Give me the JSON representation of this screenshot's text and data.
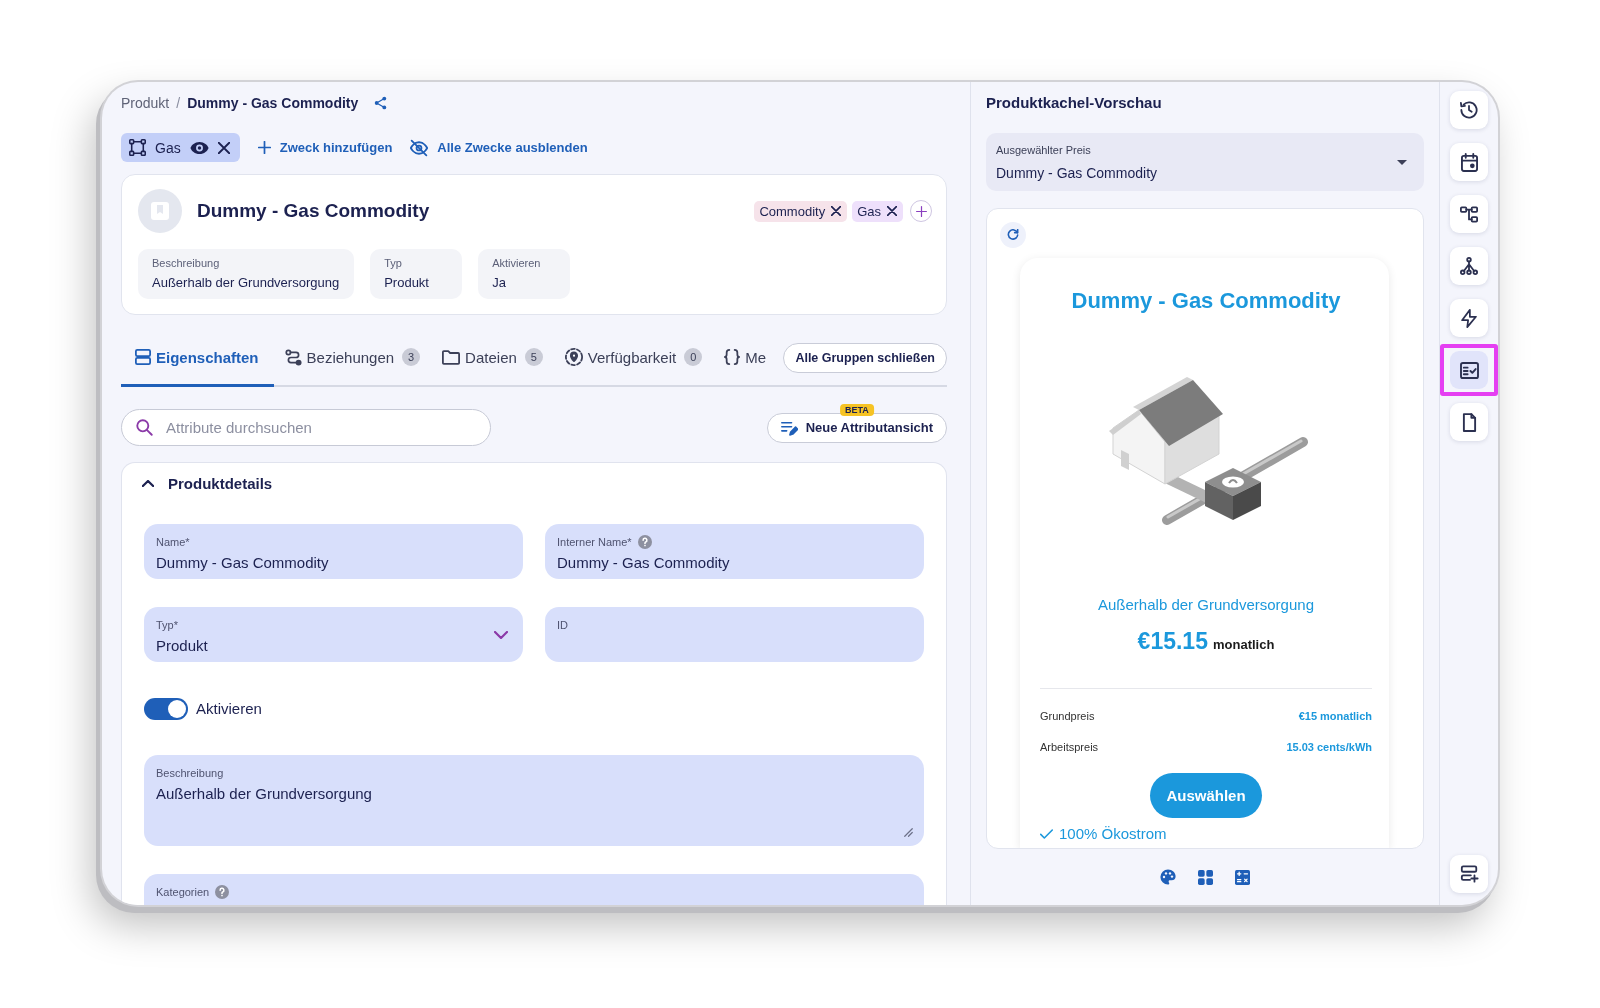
{
  "breadcrumb": {
    "items": [
      "Produkt",
      "Dummy - Gas Commodity"
    ],
    "separator": "/"
  },
  "purposes": {
    "chips": [
      {
        "label": "Gas"
      }
    ],
    "actions": [
      {
        "kind": "add",
        "label": "Zweck hinzufügen"
      },
      {
        "kind": "hide",
        "label": "Alle Zwecke ausblenden"
      }
    ]
  },
  "header": {
    "title": "Dummy - Gas Commodity",
    "tags": [
      {
        "label": "Commodity",
        "color": "#f6e3ea"
      },
      {
        "label": "Gas",
        "color": "#eee0fb"
      }
    ],
    "info": [
      {
        "label": "Beschreibung",
        "value": "Außerhalb der Grundversorgung"
      },
      {
        "label": "Typ",
        "value": "Produkt"
      },
      {
        "label": "Aktivieren",
        "value": "Ja"
      }
    ]
  },
  "tabs": {
    "items": [
      {
        "label": "Eigenschaften",
        "selected": true
      },
      {
        "label": "Beziehungen",
        "count": "3",
        "selected": false
      },
      {
        "label": "Dateien",
        "count": "5",
        "selected": false
      },
      {
        "label": "Verfügbarkeit",
        "count": "0",
        "selected": false
      },
      {
        "label": "Me",
        "selected": false
      }
    ],
    "collapse_button": "Alle Gruppen schließen"
  },
  "search": {
    "placeholder": "Attribute durchsuchen"
  },
  "view_button": {
    "label": "Neue Attributansicht",
    "badge": "BETA"
  },
  "section": {
    "title": "Produktdetails",
    "expanded": true,
    "fields": [
      {
        "kind": "text",
        "label": "Name*",
        "value": "Dummy - Gas Commodity",
        "help": false
      },
      {
        "kind": "text",
        "label": "Interner Name*",
        "value": "Dummy - Gas Commodity",
        "help": true
      },
      {
        "kind": "select",
        "label": "Typ*",
        "value": "Produkt",
        "help": false
      },
      {
        "kind": "text",
        "label": "ID",
        "help": false
      },
      {
        "kind": "toggle",
        "label": "Aktivieren",
        "on": true
      },
      {
        "kind": "textarea",
        "label": "Beschreibung",
        "value": "Außerhalb der Grundversorgung",
        "help": false
      },
      {
        "kind": "multiselect",
        "label": "Kategorien",
        "help": true
      }
    ]
  },
  "preview": {
    "title": "Produktkachel-Vorschau",
    "price_select": {
      "label": "Ausgewählter Preis",
      "value": "Dummy - Gas Commodity"
    },
    "tile": {
      "title": "Dummy - Gas Commodity",
      "subtitle": "Außerhalb der Grundversorgung",
      "price": "€15.15",
      "period": "monatlich",
      "rows": [
        {
          "label": "Grundpreis",
          "value": "€15 monatlich"
        },
        {
          "label": "Arbeitspreis",
          "value": "15.03 cents/kWh"
        }
      ],
      "button": "Auswählen",
      "features": [
        "100% Ökostrom"
      ]
    }
  },
  "rail": {
    "items": [
      {
        "selected": false
      },
      {
        "selected": false
      },
      {
        "selected": false
      },
      {
        "selected": false
      },
      {
        "selected": false
      },
      {
        "selected": true
      },
      {
        "selected": false
      }
    ],
    "bottom": [
      {
        "selected": false
      }
    ]
  }
}
